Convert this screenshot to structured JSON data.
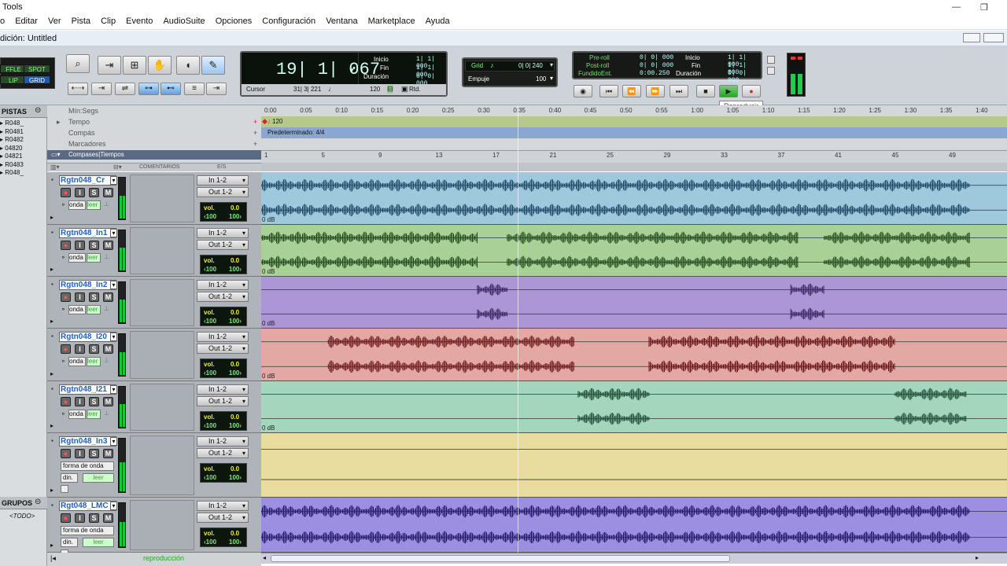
{
  "window": {
    "title": "Tools",
    "edit_title": "dición: Untitled"
  },
  "menu": [
    "o",
    "Editar",
    "Ver",
    "Pista",
    "Clip",
    "Evento",
    "AudioSuite",
    "Opciones",
    "Configuración",
    "Ventana",
    "Marketplace",
    "Ayuda"
  ],
  "modes": {
    "shuffle": "FFLE",
    "spot": "SPOT",
    "slip": "LIP",
    "grid": "GRID"
  },
  "counter": {
    "main": "19| 1| 067",
    "inicio_label": "Inicio",
    "fin_label": "Fin",
    "duracion_label": "Duración",
    "inicio": "1| 1| 000",
    "fin": "1| 1| 000",
    "duracion": "0| 0| 000",
    "cursor_label": "Cursor",
    "cursor": "31| 3| 221",
    "tempo": "120",
    "rtd": "Rtd."
  },
  "grid": {
    "label": "Grid",
    "value": "0| 0| 240",
    "empuje_label": "Empuje",
    "empuje_value": "100"
  },
  "transport": {
    "preroll_label": "Pre-roll",
    "postroll_label": "Post-roll",
    "fundido_label": "FundidoEnt.",
    "preroll": "0| 0| 000",
    "postroll": "0| 0| 000",
    "fundido": "0:00.250",
    "inicio_label": "Inicio",
    "fin_label": "Fin",
    "duracion_label": "Duración",
    "inicio": "1| 1| 000",
    "fin": "1| 1| 000",
    "duracion": "0| 0| 000"
  },
  "tooltip": "Reproducir",
  "left_panel": {
    "pistas_label": "PISTAS",
    "items": [
      "R048_",
      "R0481",
      "R0482",
      "04820",
      "04821",
      "R0483",
      "R048_"
    ],
    "grupos_label": "GRUPOS",
    "todo_label": "<TODO>"
  },
  "ruler": {
    "minsegs_label": "Mín:Segs",
    "tempo_label": "Tempo",
    "compas_label": "Compás",
    "marcadores_label": "Marcadores",
    "compases_label": "Compases|Tiempos",
    "tempo_value": "120",
    "meter_value": "Predeterminado: 4/4",
    "time_ticks": [
      "0:00",
      "0:05",
      "0:10",
      "0:15",
      "0:20",
      "0:25",
      "0:30",
      "0:35",
      "0:40",
      "0:45",
      "0:50",
      "0:55",
      "1:00",
      "1:05",
      "1:10",
      "1:15",
      "1:20",
      "1:25",
      "1:30",
      "1:35",
      "1:40"
    ],
    "bar_ticks": [
      "1",
      "5",
      "9",
      "13",
      "17",
      "21",
      "25",
      "29",
      "33",
      "37",
      "41",
      "45",
      "49"
    ]
  },
  "columns": {
    "comentarios": "COMENTARIOS",
    "es": "E/S"
  },
  "tracks": [
    {
      "name": "Rgtn048_Cr",
      "in": "In 1-2",
      "out": "Out 1-2",
      "vol_label": "vol.",
      "vol": "0.0",
      "pan_l": "‹100",
      "pan_r": "100›",
      "view": "onda",
      "mode": "leer",
      "clip_gain": "0 dB",
      "color": "#9ec8dc",
      "wave": "#1f4a6a"
    },
    {
      "name": "Rgtn048_In1",
      "in": "In 1-2",
      "out": "Out 1-2",
      "vol_label": "vol.",
      "vol": "0.0",
      "pan_l": "‹100",
      "pan_r": "100›",
      "view": "onda",
      "mode": "leer",
      "clip_gain": "0 dB",
      "color": "#a9d197",
      "wave": "#224a1a"
    },
    {
      "name": "Rgtn048_In2",
      "in": "In 1-2",
      "out": "Out 1-2",
      "vol_label": "vol.",
      "vol": "0.0",
      "pan_l": "‹100",
      "pan_r": "100›",
      "view": "onda",
      "mode": "leer",
      "clip_gain": "0 dB",
      "color": "#ad96d6",
      "wave": "#3a2260"
    },
    {
      "name": "Rgtn048_I20",
      "in": "In 1-2",
      "out": "Out 1-2",
      "vol_label": "vol.",
      "vol": "0.0",
      "pan_l": "‹100",
      "pan_r": "100›",
      "view": "onda",
      "mode": "leer",
      "clip_gain": "0 dB",
      "color": "#e3a8a4",
      "wave": "#6a1414"
    },
    {
      "name": "Rgtn048_I21",
      "in": "In 1-2",
      "out": "Out 1-2",
      "vol_label": "vol.",
      "vol": "0.0",
      "pan_l": "‹100",
      "pan_r": "100›",
      "view": "onda",
      "mode": "leer",
      "clip_gain": "0 dB",
      "color": "#a3d6bd",
      "wave": "#1a4a35"
    },
    {
      "name": "Rgtn048_In3",
      "in": "In 1-2",
      "out": "Out 1-2",
      "vol_label": "vol.",
      "vol": "0.0",
      "pan_l": "‹100",
      "pan_r": "100›",
      "view": "forma de onda",
      "din": "din.",
      "mode": "leer",
      "clip_gain": "",
      "color": "#e8dc9e",
      "wave": "#5a5020"
    },
    {
      "name": "Rgt048_LMC",
      "in": "In 1-2",
      "out": "Out 1-2",
      "vol_label": "vol.",
      "vol": "0.0",
      "pan_l": "‹100",
      "pan_r": "100›",
      "view": "forma de onda",
      "din": "din.",
      "mode": "leer",
      "clip_gain": "",
      "color": "#9c8ee0",
      "wave": "#221a6a"
    }
  ],
  "bottom": {
    "reproduccion": "reproducción"
  }
}
